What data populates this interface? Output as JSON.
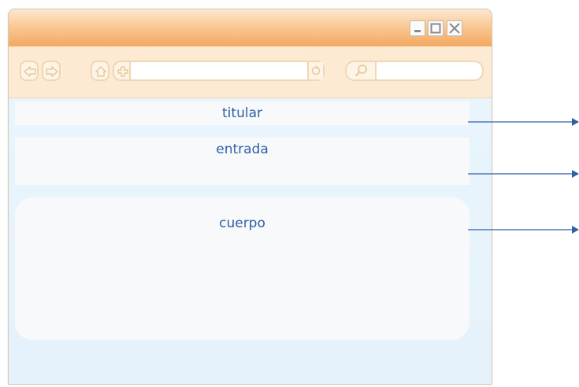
{
  "blocks": {
    "titular": "titular",
    "entrada": "entrada",
    "cuerpo": "cuerpo"
  },
  "icons": {
    "window_controls": [
      "minimize-icon",
      "maximize-icon",
      "close-icon"
    ],
    "toolbar": [
      "back-icon",
      "forward-icon",
      "home-icon",
      "add-icon",
      "reload-icon",
      "search-icon"
    ]
  },
  "colors": {
    "label_text": "#2f5fa8",
    "arrow": "#2f5fa8",
    "titlebar": "#f6b677",
    "toolbar": "#fcebd2",
    "content_background": "#e8f4fb",
    "block_background": "#f8f9fa"
  }
}
